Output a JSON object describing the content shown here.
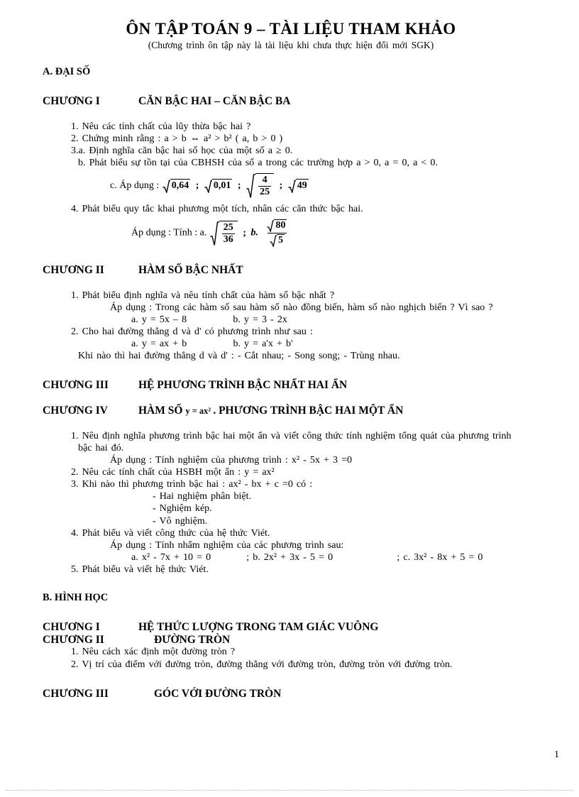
{
  "document": {
    "title": "ÔN TẬP TOÁN 9 – TÀI LIỆU THAM KHẢO",
    "subtitle": "(Chương trình ôn tập này là tài liệu khi chưa thực hiện đổi mới SGK)",
    "page_number": "1"
  },
  "part_a": {
    "heading": "A. ĐẠI SỐ",
    "chapters": [
      {
        "label": "CHƯƠNG I",
        "title": "CĂN BẬC HAI – CĂN BẬC BA",
        "items": [
          "1. Nêu các tính  chất của lũy  thừa bậc hai ?",
          "2. Chứng minh  rằng : a > b ⇔ a² > b² ( a, b > 0 )",
          "3.a. Định nghĩa  căn bậc hai số học của một số a ≥ 0.",
          "b. Phát biểu sự tồn tại của CBHSH của số a trong các trường hợp a > 0, a = 0, a < 0.",
          "c. Áp dụng :",
          "4. Phát biểu  quy tắc khai phương một tích,  nhân  các căn thức bậc hai.",
          "Áp dụng : Tính  : a."
        ],
        "formula1": {
          "caption": "c. Áp dụng :",
          "terms": [
            "0,64",
            "0,01",
            "4/25",
            "49"
          ],
          "frac_num": "4",
          "frac_den": "25",
          "t1": "0,64",
          "t2": "0,01",
          "t4": "49",
          "sep": ";"
        },
        "formula2": {
          "caption": "Áp dụng : Tính  : a.",
          "a_num": "25",
          "a_den": "36",
          "b_label": "b.",
          "b_num": "80",
          "b_den": "5",
          "sep": ";"
        }
      },
      {
        "label": "CHƯƠNG II",
        "title": "HÀM SỐ BẬC NHẤT",
        "items": [
          "1. Phát biểu  định nghĩa  và nêu tính  chất của hàm số bậc nhất ?",
          "Áp dụng : Trong các hàm số sau hàm số nào đồng biến,  hàm số nào nghịch  biến ? Vì sao ?",
          "a. y = 5x – 8",
          "b. y = 3 - 2x",
          "2. Cho hai  đường thẳng  d và d' có phương trình  như sau :",
          "a. y = ax + b",
          "b. y = a'x + b'",
          "Khi nào thì  hai đường thẳng   d và d' : - Cắt nhau;  - Song song;  - Trùng  nhau."
        ]
      },
      {
        "label": "CHƯƠNG III",
        "title": "HỆ PHƯƠNG TRÌNH BẬC NHẤT HAI ẨN",
        "items": []
      },
      {
        "label": "CHƯƠNG IV",
        "title_part1": "HÀM SỐ ",
        "title_eq": "y = ax² ",
        "title_part2": ". PHƯƠNG TRÌNH BẬC HAI MỘT ẨN",
        "items": [
          "1. Nêu định nghĩa  phương trình  bậc hai một ẩn và viết  công thức tính  nghiệm  tổng quát của phương trình",
          "bậc hai đó.",
          "Áp dụng : Tính  nghiệm  của phương trình  : x² - 5x + 3 =0",
          "2. Nêu các tính  chất của HSBH một ẩn : y = ax²",
          "3. Khi nào thì  phương trình  bậc hai : ax² - bx + c =0   có :",
          "- Hai nghiệm  phân biệt.",
          "- Nghiệm  kép.",
          "- Vô nghiệm.",
          "4. Phát biểu và viết  công thức của hệ thức Viét.",
          "Áp dụng : Tính  nhẩm  nghiệm  của các phương trình  sau:",
          "a.  x² - 7x + 10 = 0",
          "; b. 2x² + 3x - 5 = 0",
          "; c. 3x² - 8x + 5 = 0",
          "5. Phát biểu và viết  hệ thức Viét."
        ]
      }
    ]
  },
  "part_b": {
    "heading": "B. HÌNH HỌC",
    "chapters": [
      {
        "label": "CHƯƠNG I",
        "title": "HỆ THỨC LƯỢNG TRONG TAM GIÁC  VUÔNG",
        "items": []
      },
      {
        "label": "CHƯƠNG II",
        "title": "ĐƯỜNG TRÒN",
        "items": [
          "1. Nêu cách xác định một đường tròn ?",
          "2. Vị trí của điểm với  đường tròn, đường thẳng với  đường tròn, đường tròn với  đường tròn."
        ]
      },
      {
        "label": "CHƯƠNG III",
        "title": "GÓC VỚI ĐƯỜNG TRÒN",
        "items": []
      }
    ]
  }
}
